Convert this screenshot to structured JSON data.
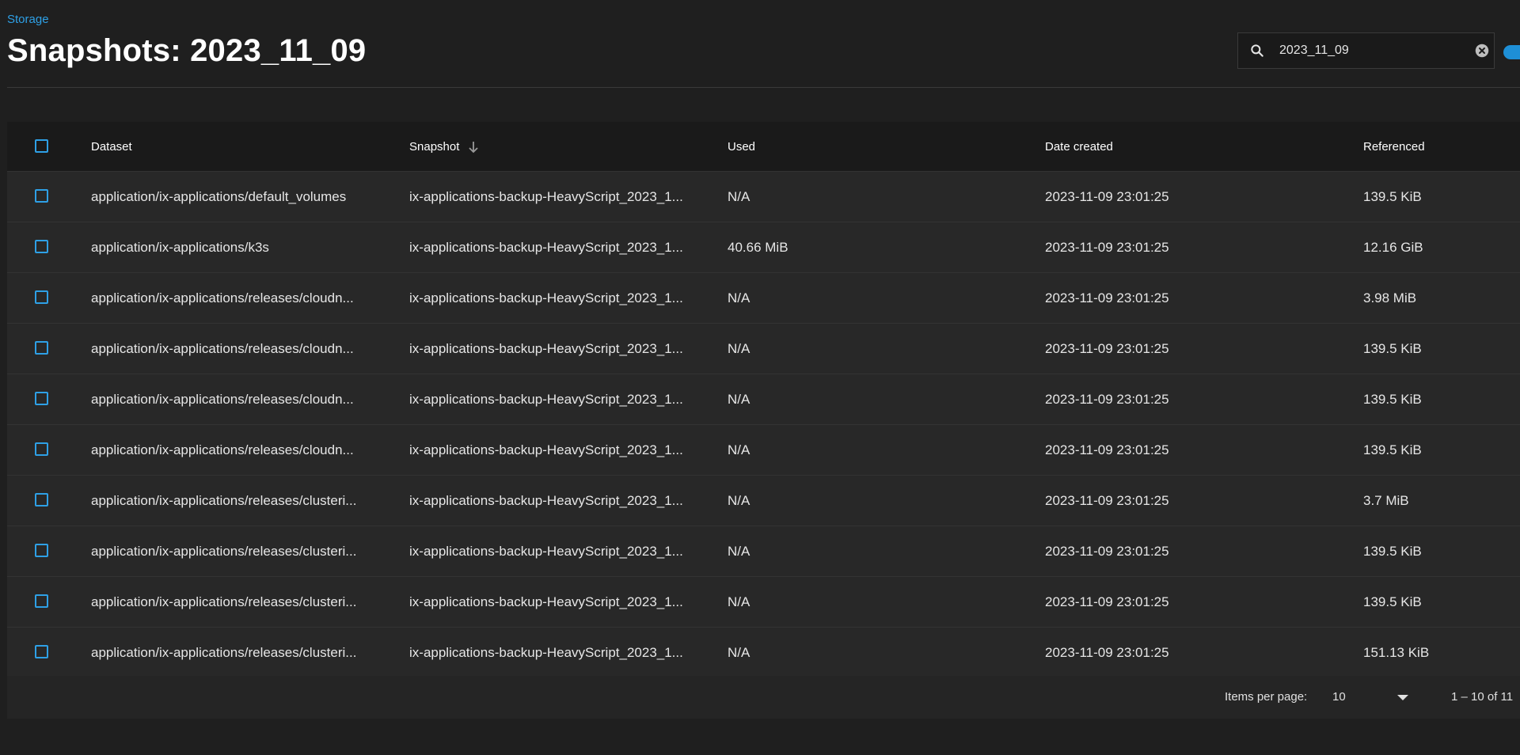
{
  "breadcrumb": "Storage",
  "page_title": "Snapshots: 2023_11_09",
  "search": {
    "value": "2023_11_09",
    "placeholder": "Search"
  },
  "table": {
    "columns": {
      "dataset": "Dataset",
      "snapshot": "Snapshot",
      "used": "Used",
      "date_created": "Date created",
      "referenced": "Referenced"
    },
    "sort": {
      "column": "snapshot",
      "direction": "descending"
    },
    "rows": [
      {
        "dataset": "application/ix-applications/default_volumes",
        "snapshot": "ix-applications-backup-HeavyScript_2023_1...",
        "used": "N/A",
        "date_created": "2023-11-09 23:01:25",
        "referenced": "139.5 KiB"
      },
      {
        "dataset": "application/ix-applications/k3s",
        "snapshot": "ix-applications-backup-HeavyScript_2023_1...",
        "used": "40.66 MiB",
        "date_created": "2023-11-09 23:01:25",
        "referenced": "12.16 GiB"
      },
      {
        "dataset": "application/ix-applications/releases/cloudn...",
        "snapshot": "ix-applications-backup-HeavyScript_2023_1...",
        "used": "N/A",
        "date_created": "2023-11-09 23:01:25",
        "referenced": "3.98 MiB"
      },
      {
        "dataset": "application/ix-applications/releases/cloudn...",
        "snapshot": "ix-applications-backup-HeavyScript_2023_1...",
        "used": "N/A",
        "date_created": "2023-11-09 23:01:25",
        "referenced": "139.5 KiB"
      },
      {
        "dataset": "application/ix-applications/releases/cloudn...",
        "snapshot": "ix-applications-backup-HeavyScript_2023_1...",
        "used": "N/A",
        "date_created": "2023-11-09 23:01:25",
        "referenced": "139.5 KiB"
      },
      {
        "dataset": "application/ix-applications/releases/cloudn...",
        "snapshot": "ix-applications-backup-HeavyScript_2023_1...",
        "used": "N/A",
        "date_created": "2023-11-09 23:01:25",
        "referenced": "139.5 KiB"
      },
      {
        "dataset": "application/ix-applications/releases/clusteri...",
        "snapshot": "ix-applications-backup-HeavyScript_2023_1...",
        "used": "N/A",
        "date_created": "2023-11-09 23:01:25",
        "referenced": "3.7 MiB"
      },
      {
        "dataset": "application/ix-applications/releases/clusteri...",
        "snapshot": "ix-applications-backup-HeavyScript_2023_1...",
        "used": "N/A",
        "date_created": "2023-11-09 23:01:25",
        "referenced": "139.5 KiB"
      },
      {
        "dataset": "application/ix-applications/releases/clusteri...",
        "snapshot": "ix-applications-backup-HeavyScript_2023_1...",
        "used": "N/A",
        "date_created": "2023-11-09 23:01:25",
        "referenced": "139.5 KiB"
      },
      {
        "dataset": "application/ix-applications/releases/clusteri...",
        "snapshot": "ix-applications-backup-HeavyScript_2023_1...",
        "used": "N/A",
        "date_created": "2023-11-09 23:01:25",
        "referenced": "151.13 KiB"
      }
    ]
  },
  "paginator": {
    "items_per_page_label": "Items per page:",
    "items_per_page_value": "10",
    "range_label": "1 – 10 of 11"
  },
  "colors": {
    "accent": "#2ea0e6",
    "background": "#1f1f1f",
    "table_row": "#282828",
    "header_row": "#1a1a1a"
  },
  "icons": {
    "search": "search-icon",
    "clear": "clear-icon",
    "sort": "arrow-down-icon",
    "dropdown": "caret-down-icon"
  }
}
